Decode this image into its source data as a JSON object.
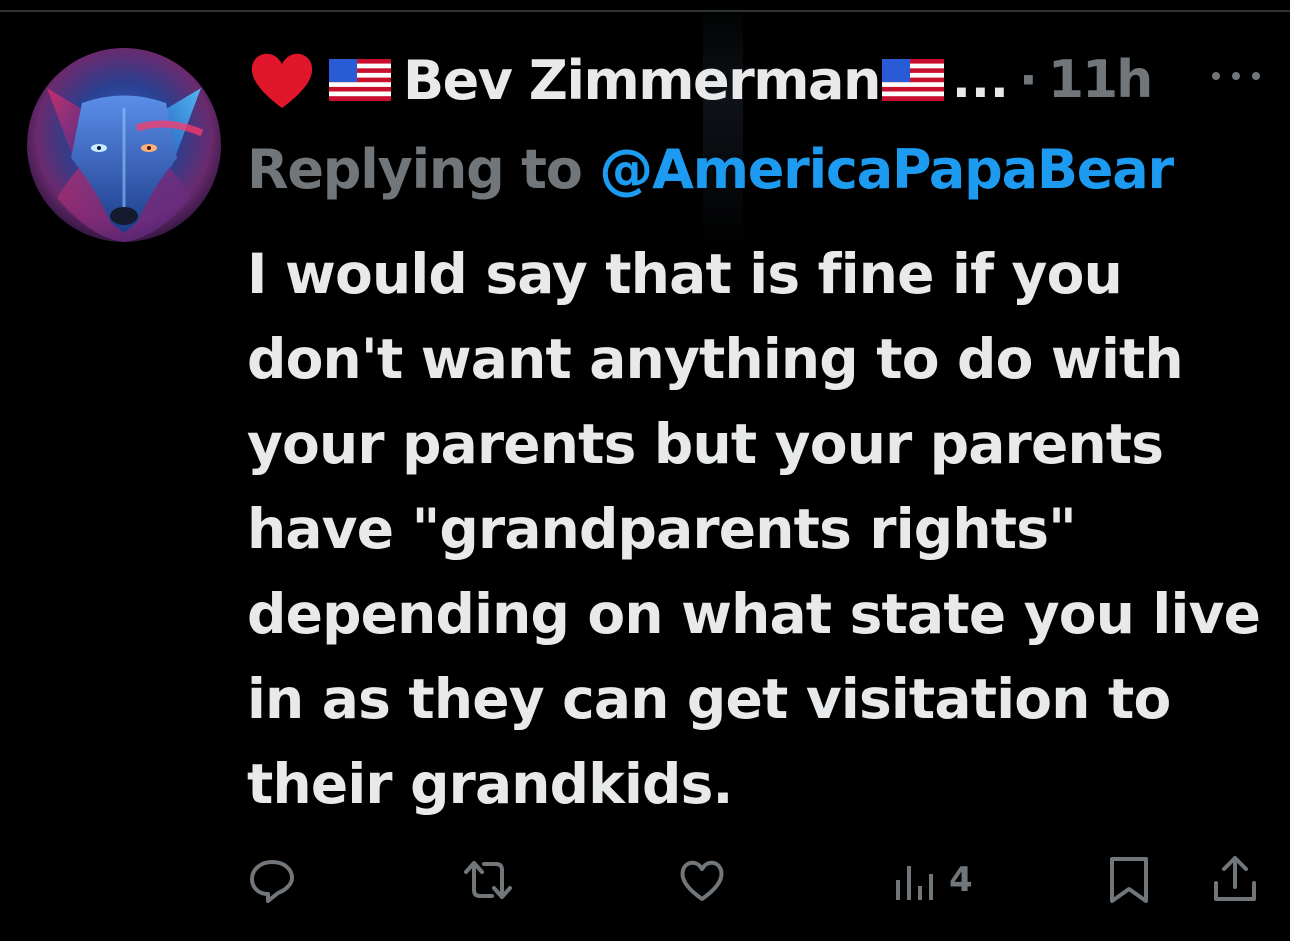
{
  "tweet": {
    "author": {
      "display_name": "Bev Zimmerman",
      "truncation": "...",
      "avatar_icon": "wolf-avatar",
      "emoji_prefix": [
        "red-heart-icon",
        "us-flag-icon"
      ],
      "emoji_suffix": [
        "us-flag-icon"
      ]
    },
    "separator": "·",
    "time": "11h",
    "more_icon": "more-horizontal-icon",
    "reply_context": {
      "prefix": "Replying to ",
      "handle": "@AmericaPapaBear"
    },
    "body_lines": [
      "I would say that is fine if you",
      "don't want anything to do with",
      "your parents but your parents",
      "have \"grandparents rights\"",
      "depending on what state you live",
      "in as they can get visitation to",
      "their grandkids."
    ],
    "actions": {
      "reply_icon": "reply-icon",
      "repost_icon": "repost-icon",
      "like_icon": "heart-outline-icon",
      "views_icon": "analytics-icon",
      "views_count": "4",
      "bookmark_icon": "bookmark-icon",
      "share_icon": "share-icon"
    }
  },
  "colors": {
    "background": "#000000",
    "text_primary": "#e7e9ea",
    "text_secondary": "#71767b",
    "accent": "#1d9bf0",
    "divider": "#2f3336"
  }
}
